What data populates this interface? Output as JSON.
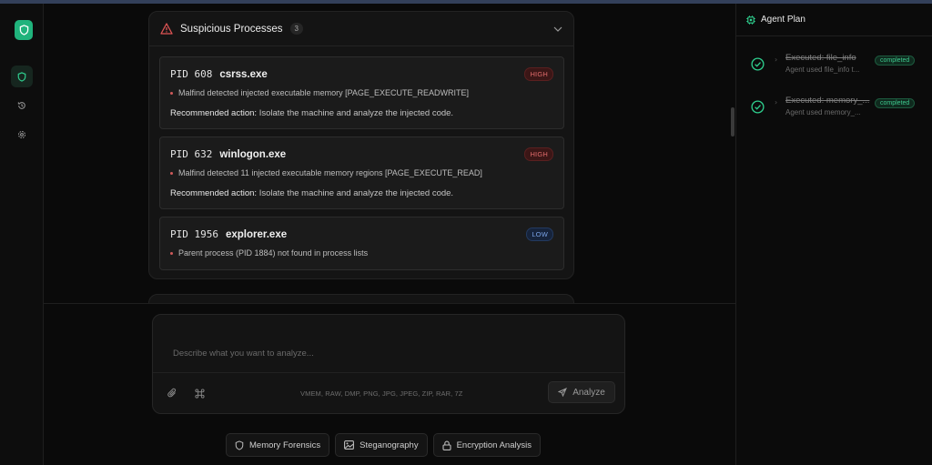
{
  "sidebar": {
    "logo_icon": "shield-icon",
    "items": [
      {
        "icon": "shield-icon",
        "active": true
      },
      {
        "icon": "history-icon",
        "active": false
      },
      {
        "icon": "gear-icon",
        "active": false
      }
    ]
  },
  "findings": {
    "title": "Suspicious Processes",
    "count": "3",
    "processes": [
      {
        "pid": "PID 608",
        "name": "csrss.exe",
        "severity": "HIGH",
        "detail": "Malfind detected injected executable memory [PAGE_EXECUTE_READWRITE]",
        "rec_label": "Recommended action:",
        "rec_text": "Isolate the machine and analyze the injected code."
      },
      {
        "pid": "PID 632",
        "name": "winlogon.exe",
        "severity": "HIGH",
        "detail": "Malfind detected 11 injected executable memory regions [PAGE_EXECUTE_READ]",
        "rec_label": "Recommended action:",
        "rec_text": "Isolate the machine and analyze the injected code."
      },
      {
        "pid": "PID 1956",
        "name": "explorer.exe",
        "severity": "LOW",
        "detail": "Parent process (PID 1884) not found in process lists"
      }
    ]
  },
  "composer": {
    "placeholder": "Describe what you want to analyze...",
    "formats": "VMEM, RAW, DMP, PNG, JPG, JPEG, ZIP, RAR, 7Z",
    "analyze_label": "Analyze"
  },
  "quick_actions": [
    {
      "label": "Memory Forensics",
      "icon": "shield-icon"
    },
    {
      "label": "Steganography",
      "icon": "image-icon"
    },
    {
      "label": "Encryption Analysis",
      "icon": "lock-icon"
    }
  ],
  "plan": {
    "title": "Agent Plan",
    "steps": [
      {
        "title": "Executed: file_info",
        "subtitle": "Agent used file_info t...",
        "status": "completed"
      },
      {
        "title": "Executed: memory_...",
        "subtitle": "Agent used memory_...",
        "status": "completed"
      }
    ]
  },
  "colors": {
    "accent": "#20b37c",
    "high": "#e06b6b",
    "low": "#7aa3e6",
    "completed": "#3ec88e"
  }
}
